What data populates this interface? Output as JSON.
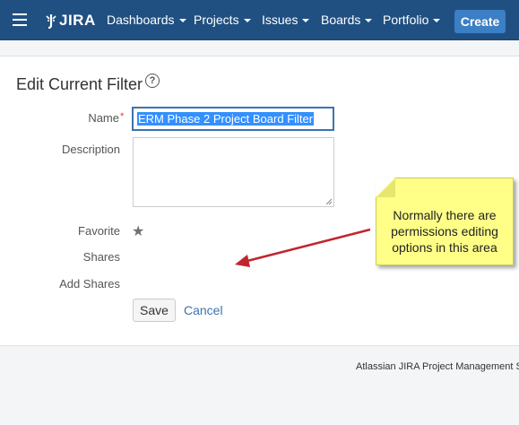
{
  "topbar": {
    "logo": "JIRA",
    "nav": [
      {
        "label": "Dashboards"
      },
      {
        "label": "Projects"
      },
      {
        "label": "Issues"
      },
      {
        "label": "Boards"
      },
      {
        "label": "Portfolio"
      }
    ],
    "create_label": "Create"
  },
  "page": {
    "title": "Edit Current Filter",
    "help_glyph": "?"
  },
  "form": {
    "name_label": "Name",
    "required_mark": "*",
    "name_value": "ERM Phase 2 Project Board Filter",
    "description_label": "Description",
    "description_value": "",
    "favorite_label": "Favorite",
    "shares_label": "Shares",
    "add_shares_label": "Add Shares",
    "save_label": "Save",
    "cancel_label": "Cancel"
  },
  "callout": {
    "text": "Normally there are permissions editing options in this area",
    "color": "#ffff88"
  },
  "footer": {
    "text": "Atlassian JIRA Project Management S"
  },
  "colors": {
    "header": "#205081",
    "accent": "#3b73af",
    "arrow": "#c0262d"
  }
}
